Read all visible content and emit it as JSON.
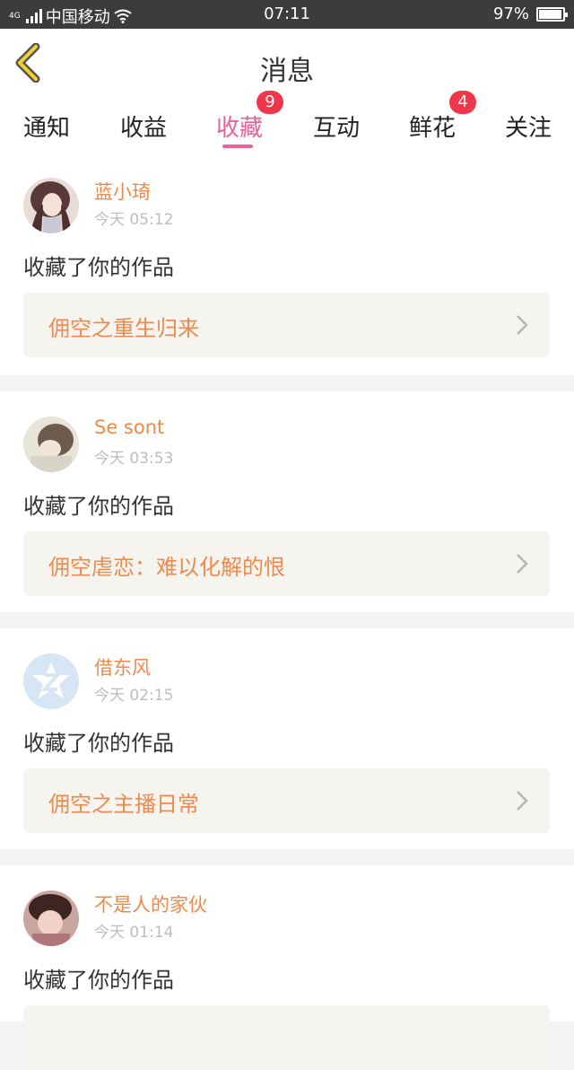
{
  "status_bar": {
    "network_tag": "4G",
    "carrier": "中国移动",
    "time": "07:11",
    "battery": "97%",
    "battery_level": 0.97
  },
  "header": {
    "title": "消息",
    "back_icon": "chevron-left-icon"
  },
  "tabs": [
    {
      "label": "通知",
      "badge": null,
      "active": false
    },
    {
      "label": "收益",
      "badge": null,
      "active": false
    },
    {
      "label": "收藏",
      "badge": "9",
      "active": true
    },
    {
      "label": "互动",
      "badge": null,
      "active": false
    },
    {
      "label": "鲜花",
      "badge": "4",
      "active": false
    },
    {
      "label": "关注",
      "badge": null,
      "active": false
    }
  ],
  "colors": {
    "accent_pink": "#e5629a",
    "name_orange": "#ee8a4e",
    "badge_red": "#f0374a"
  },
  "messages": [
    {
      "user": "蓝小琦",
      "time": "今天 05:12",
      "action": "收藏了你的作品",
      "work": "佣空之重生归来"
    },
    {
      "user": "Se sont",
      "time": "今天 03:53",
      "action": "收藏了你的作品",
      "work": "佣空虐恋：难以化解的恨"
    },
    {
      "user": "借东风",
      "time": "今天 02:15",
      "action": "收藏了你的作品",
      "work": "佣空之主播日常"
    },
    {
      "user": "不是人的家伙",
      "time": "今天 01:14",
      "action": "收藏了你的作品",
      "work": ""
    }
  ]
}
